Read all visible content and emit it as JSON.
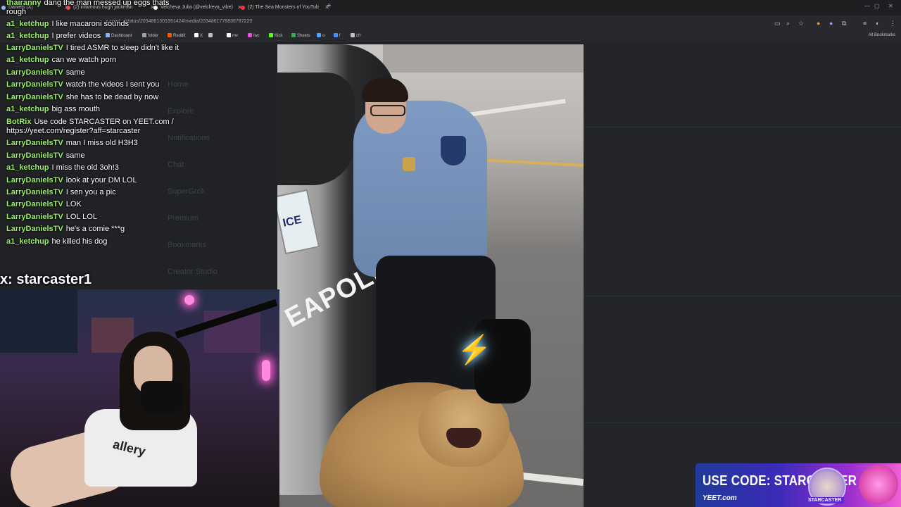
{
  "browser": {
    "tabs": [
      {
        "label": "Daniels (X)",
        "fav": "#8ab4f8"
      },
      {
        "label": "(2) infamous hugh jackman",
        "fav": "#ff4444"
      },
      {
        "label": "Velcheva Julia (@velcheva_vibe)",
        "fav": "#ffffff"
      },
      {
        "label": "(2) The Sea Monsters of YouTub",
        "fav": "#ff3333"
      }
    ],
    "url": "x.com/.../status/2034861301991424/media/2034861778836787220",
    "bookmarks": [
      "Dashboard",
      "folder",
      "Reddit",
      "X",
      "mv",
      "iwc",
      "Kick",
      "Sheets",
      "o",
      "f",
      "cfr"
    ],
    "all_bookmarks": "All Bookmarks"
  },
  "ghost_ui": {
    "nav": [
      "Home",
      "Explore",
      "Notifications",
      "Chat",
      "SuperGrok",
      "Premium",
      "Bookmarks",
      "Creator Studio"
    ]
  },
  "chat": {
    "messages": [
      {
        "user": "thairanny",
        "text": "dang the man messed up eggs thats"
      },
      {
        "user": "",
        "text": "rough"
      },
      {
        "user": "a1_ketchup",
        "text": "I like macaroni sounds"
      },
      {
        "user": "a1_ketchup",
        "text": "I prefer videos"
      },
      {
        "user": "LarryDanielsTV",
        "text": "I tired ASMR to sleep didn't like it"
      },
      {
        "user": "a1_ketchup",
        "text": "can we watch porn"
      },
      {
        "user": "LarryDanielsTV",
        "text": "same"
      },
      {
        "user": "LarryDanielsTV",
        "text": "watch the videos I sent you"
      },
      {
        "user": "LarryDanielsTV",
        "text": "she has to be dead by now"
      },
      {
        "user": "a1_ketchup",
        "text": "big ass mouth"
      },
      {
        "user": "BotRix",
        "text": "Use code STARCASTER on YEET.com /"
      },
      {
        "user": "",
        "text": "https://yeet.com/register?aff=starcaster"
      },
      {
        "user": "LarryDanielsTV",
        "text": "man I miss old H3H3"
      },
      {
        "user": "LarryDanielsTV",
        "text": "same"
      },
      {
        "user": "a1_ketchup",
        "text": "I miss the old 3oh!3"
      },
      {
        "user": "LarryDanielsTV",
        "text": "look at your DM LOL"
      },
      {
        "user": "LarryDanielsTV",
        "text": "I sen you a pic"
      },
      {
        "user": "LarryDanielsTV",
        "text": "LOK"
      },
      {
        "user": "LarryDanielsTV",
        "text": "LOL LOL"
      },
      {
        "user": "LarryDanielsTV",
        "text": "he's a comie ***g"
      },
      {
        "user": "a1_ketchup",
        "text": "he killed his dog"
      }
    ]
  },
  "handle": "x: starcaster1",
  "webcam": {
    "shirt_text": "allery"
  },
  "meme": {
    "plate_text": "ICE",
    "car_text": "EAPOLIS"
  },
  "promo": {
    "label": "USE CODE:",
    "code": "STARCASTER",
    "site": "YEET.com",
    "tag": "STARCASTER"
  }
}
